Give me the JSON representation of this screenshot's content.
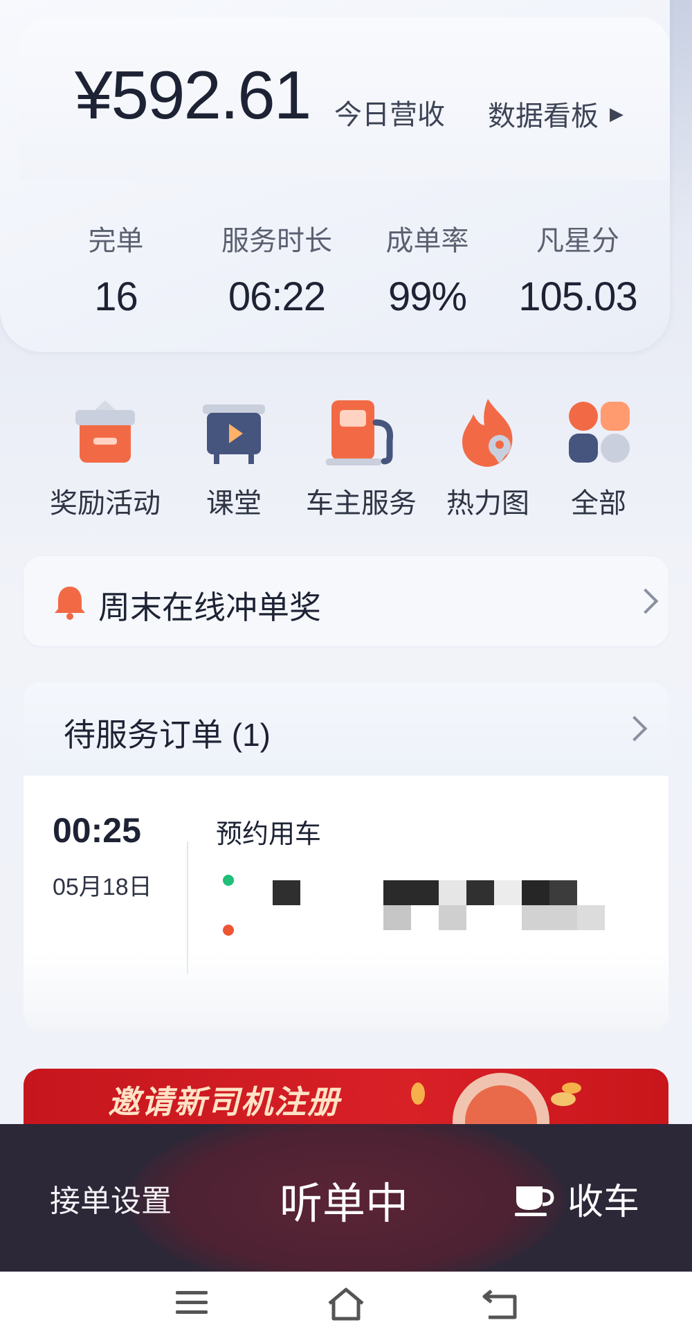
{
  "earnings": {
    "amount": "¥592.61",
    "amount_label": "今日营收",
    "dashboard_label": "数据看板"
  },
  "stats": [
    {
      "label": "完单",
      "value": "16"
    },
    {
      "label": "服务时长",
      "value": "06:22"
    },
    {
      "label": "成单率",
      "value": "99%"
    },
    {
      "label": "凡星分",
      "value": "105.03"
    }
  ],
  "shortcuts": [
    {
      "label": "奖励活动",
      "icon": "gift-box-icon"
    },
    {
      "label": "课堂",
      "icon": "classroom-video-icon"
    },
    {
      "label": "车主服务",
      "icon": "fuel-pump-icon"
    },
    {
      "label": "热力图",
      "icon": "flame-location-icon"
    },
    {
      "label": "全部",
      "icon": "grid-all-icon"
    }
  ],
  "notice": {
    "icon": "bell-icon",
    "text": "周末在线冲单奖"
  },
  "orders": {
    "title": "待服务订单",
    "count": "(1)",
    "item": {
      "time": "00:25",
      "date": "05月18日",
      "type": "预约用车",
      "start_dot_color": "#1fbf7a",
      "end_dot_color": "#ee5533"
    }
  },
  "banner": {
    "text": "邀请新司机注册"
  },
  "bottom_bar": {
    "settings_label": "接单设置",
    "status_label": "听单中",
    "close_label": "收车",
    "close_icon": "coffee-cup-icon"
  },
  "colors": {
    "accent_red": "#d82027",
    "dark_bar": "#2c2838",
    "text_primary": "#1d2334"
  }
}
